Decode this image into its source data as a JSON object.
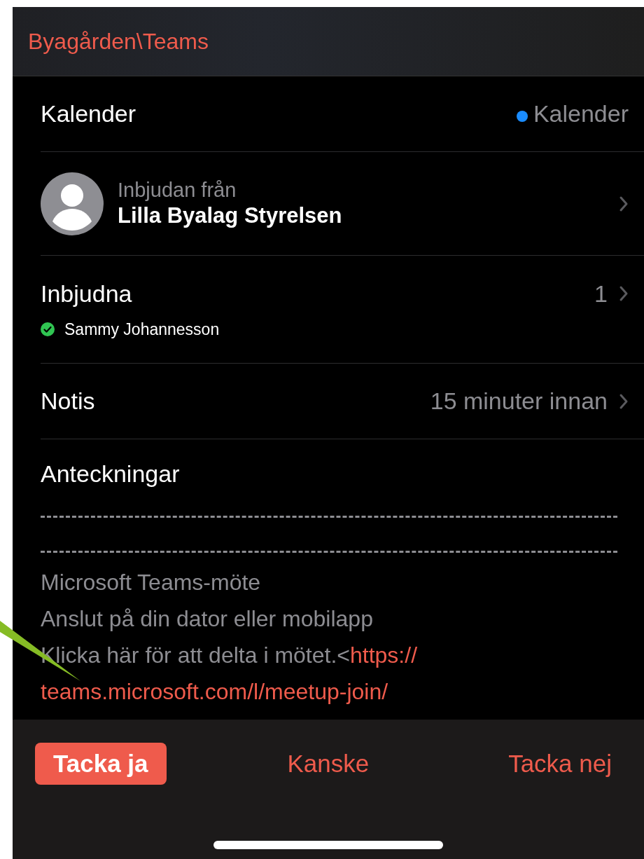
{
  "header": {
    "title": "Byagården\\Teams"
  },
  "calendar": {
    "label": "Kalender",
    "value": "Kalender",
    "color": "#1a8cff"
  },
  "organizer": {
    "caption": "Inbjudan från",
    "name": "Lilla Byalag Styrelsen"
  },
  "invitees": {
    "label": "Inbjudna",
    "count": "1",
    "people": [
      {
        "name": "Sammy Johannesson",
        "accepted": true
      }
    ]
  },
  "alert": {
    "label": "Notis",
    "value": "15 minuter innan"
  },
  "notes": {
    "label": "Anteckningar",
    "lines": [
      {
        "kind": "rule"
      },
      {
        "kind": "rule"
      },
      {
        "kind": "text",
        "text": "Microsoft Teams-möte"
      },
      {
        "kind": "text",
        "text": "Anslut på din dator eller mobilapp"
      },
      {
        "kind": "text",
        "text": "Klicka här för att delta i mötet.<",
        "link": "https://"
      },
      {
        "kind": "link",
        "link": "teams.microsoft.com/l/meetup-join/"
      }
    ]
  },
  "responses": [
    {
      "label": "Tacka ja",
      "selected": true
    },
    {
      "label": "Kanske",
      "selected": false
    },
    {
      "label": "Tacka nej",
      "selected": false
    }
  ]
}
